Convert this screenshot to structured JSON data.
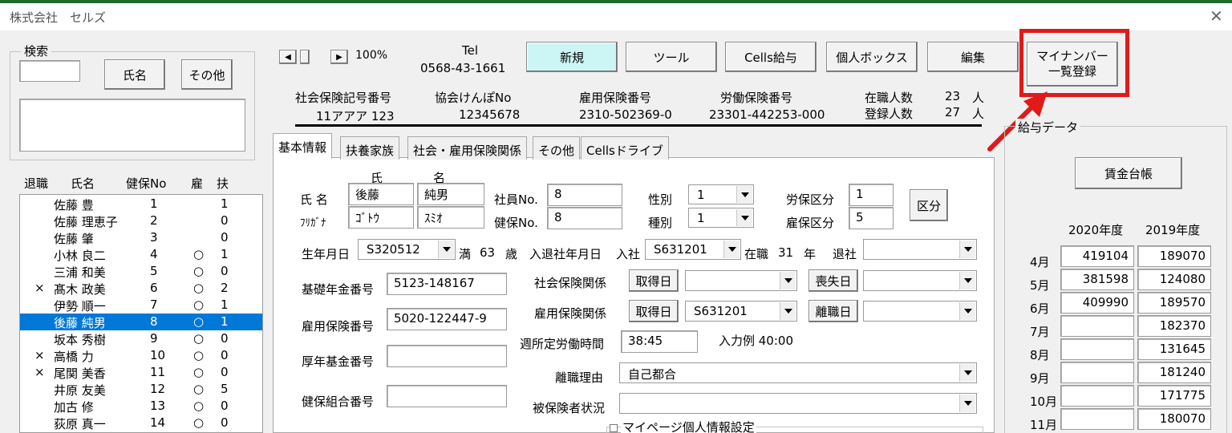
{
  "window": {
    "title": "株式会社　セルズ",
    "close": "✕"
  },
  "search": {
    "group_label": "検索",
    "name_button": "氏名",
    "other_button": "その他"
  },
  "zoom": "100%",
  "tel": {
    "label": "Tel",
    "number": "0568-43-1661"
  },
  "toolbar": {
    "new": "新規",
    "tools": "ツール",
    "cells_salary": "Cells給与",
    "personal_box": "個人ボックス",
    "edit": "編集",
    "mynumber_line1": "マイナンバー",
    "mynumber_line2": "一覧登録"
  },
  "company": {
    "social_ins_label": "社会保険記号番号",
    "social_ins_value": "11アアア 123",
    "kyokai_label": "協会けんぽNo",
    "kyokai_value": "12345678",
    "employment_ins_label": "雇用保険番号",
    "employment_ins_value": "2310-502369-0",
    "labor_ins_label": "労働保険番号",
    "labor_ins_value": "23301-442253-000",
    "employed_label": "在職人数",
    "employed_count": "23",
    "employed_unit": "人",
    "registered_label": "登録人数",
    "registered_count": "27",
    "registered_unit": "人"
  },
  "list": {
    "headers": [
      "退職",
      "氏名",
      "健保No",
      "雇",
      "扶"
    ],
    "rows": [
      {
        "ret": "",
        "name": "佐藤 豊",
        "no": "1",
        "emp": "",
        "dep": "1"
      },
      {
        "ret": "",
        "name": "佐藤 理恵子",
        "no": "2",
        "emp": "",
        "dep": "0"
      },
      {
        "ret": "",
        "name": "佐藤 肇",
        "no": "3",
        "emp": "",
        "dep": "0"
      },
      {
        "ret": "",
        "name": "小林 良二",
        "no": "4",
        "emp": "○",
        "dep": "1"
      },
      {
        "ret": "",
        "name": "三浦 和美",
        "no": "5",
        "emp": "○",
        "dep": "0"
      },
      {
        "ret": "×",
        "name": "髙木 政美",
        "no": "6",
        "emp": "○",
        "dep": "2"
      },
      {
        "ret": "",
        "name": "伊勢 順一",
        "no": "7",
        "emp": "○",
        "dep": "1"
      },
      {
        "ret": "",
        "name": "後藤 純男",
        "no": "8",
        "emp": "○",
        "dep": "1"
      },
      {
        "ret": "",
        "name": "坂本 秀樹",
        "no": "9",
        "emp": "○",
        "dep": "0"
      },
      {
        "ret": "×",
        "name": "高橋 力",
        "no": "10",
        "emp": "○",
        "dep": "0"
      },
      {
        "ret": "×",
        "name": "尾関 美香",
        "no": "11",
        "emp": "○",
        "dep": "0"
      },
      {
        "ret": "",
        "name": "井原 友美",
        "no": "12",
        "emp": "○",
        "dep": "5"
      },
      {
        "ret": "",
        "name": "加古 修",
        "no": "13",
        "emp": "○",
        "dep": "0"
      },
      {
        "ret": "",
        "name": "荻原 真一",
        "no": "14",
        "emp": "○",
        "dep": "0"
      }
    ]
  },
  "tabs": [
    "基本情報",
    "扶養家族",
    "社会・雇用保険関係",
    "その他",
    "Cellsドライブ"
  ],
  "basic": {
    "family_hdr": "氏",
    "given_hdr": "名",
    "name_label": "氏 名",
    "family": "後藤",
    "given": "純男",
    "kana_label": "ﾌﾘｶﾞﾅ",
    "kana_family": "ｺﾞﾄｳ",
    "kana_given": "ｽﾐｵ",
    "emp_no_label": "社員No.",
    "emp_no": "8",
    "health_no_label": "健保No.",
    "health_no": "8",
    "gender_label": "性別",
    "gender": "1",
    "type_label": "種別",
    "type": "1",
    "labor_cat_label": "労保区分",
    "labor_cat": "1",
    "emp_cat_label": "雇保区分",
    "emp_cat": "5",
    "category_button": "区分",
    "birth_label": "生年月日",
    "birth": "S320512",
    "age_prefix": "満",
    "age": "63",
    "age_unit": "歳",
    "hire_label": "入退社年月日",
    "join_label": "入社",
    "join": "S631201",
    "tenure_label": "在職",
    "tenure": "31",
    "tenure_unit": "年",
    "leave_label": "退社",
    "leave": "",
    "pension_label": "基礎年金番号",
    "pension": "5123-148167",
    "social_rel_label": "社会保険関係",
    "acquire_button": "取得日",
    "social_acq": "",
    "lose_button": "喪失日",
    "social_lose": "",
    "emp_ins_label": "雇用保険番号",
    "emp_ins": "5020-122447-9",
    "emp_rel_label": "雇用保険関係",
    "acquire_button2": "取得日",
    "emp_acq": "S631201",
    "separation_button": "離職日",
    "emp_sep": "",
    "weekly_label": "週所定労働時間",
    "weekly": "38:45",
    "example": "入力例  40:00",
    "fund_label": "厚年基金番号",
    "fund": "",
    "reason_label": "離職理由",
    "reason": "自己都合",
    "union_label": "健保組合番号",
    "union": "",
    "insured_label": "被保険者状況",
    "insured": "",
    "mypage_label": "マイページ個人情報設定"
  },
  "salary": {
    "group_label": "給与データ",
    "ledger_button": "賃金台帳",
    "year1": "2020年度",
    "year2": "2019年度",
    "rows": [
      {
        "m": "4月",
        "a": "419104",
        "b": "189070"
      },
      {
        "m": "5月",
        "a": "381598",
        "b": "124080"
      },
      {
        "m": "6月",
        "a": "409990",
        "b": "189570"
      },
      {
        "m": "7月",
        "a": "",
        "b": "182370"
      },
      {
        "m": "8月",
        "a": "",
        "b": "131645"
      },
      {
        "m": "9月",
        "a": "",
        "b": "181240"
      },
      {
        "m": "10月",
        "a": "",
        "b": "171775"
      },
      {
        "m": "11月",
        "a": "",
        "b": "180070"
      }
    ]
  },
  "colors": {
    "highlight": "#e01a1a",
    "selection": "#0078d7",
    "new_button": "#ccf6f6"
  }
}
